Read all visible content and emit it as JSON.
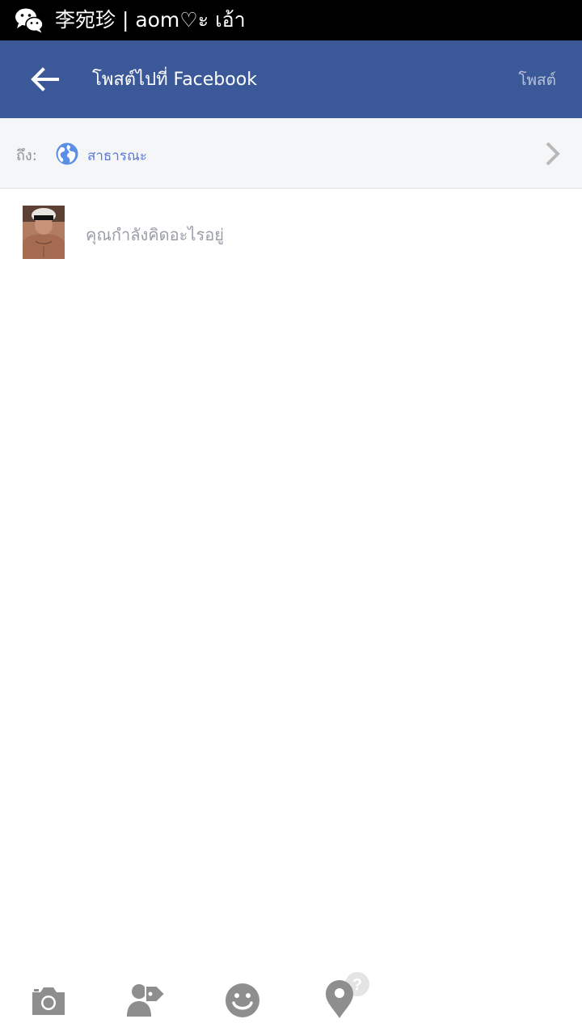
{
  "status_bar": {
    "app_icon": "wechat-icon",
    "notification_text": "李宛珍 | aom♡ะ เอ้า"
  },
  "app_bar": {
    "back_icon": "arrow-left-icon",
    "title": "โพสต์ไปที่ Facebook",
    "post_label": "โพสต์"
  },
  "audience": {
    "label": "ถึง:",
    "icon": "globe-icon",
    "value": "สาธารณะ",
    "chevron_icon": "chevron-right-icon"
  },
  "composer": {
    "avatar": "user-avatar",
    "placeholder": "คุณกำลังคิดอะไรอยู่",
    "value": ""
  },
  "toolbar": {
    "items": [
      "camera-icon",
      "tag-people-icon",
      "feeling-smiley-icon",
      "location-pin-icon"
    ]
  },
  "colors": {
    "status_bar": "#000000",
    "app_bar": "#3b5998",
    "audience_bg": "#f5f6f8",
    "accent_blue": "#5b7bd5",
    "icon_gray": "#8e8e8e"
  }
}
